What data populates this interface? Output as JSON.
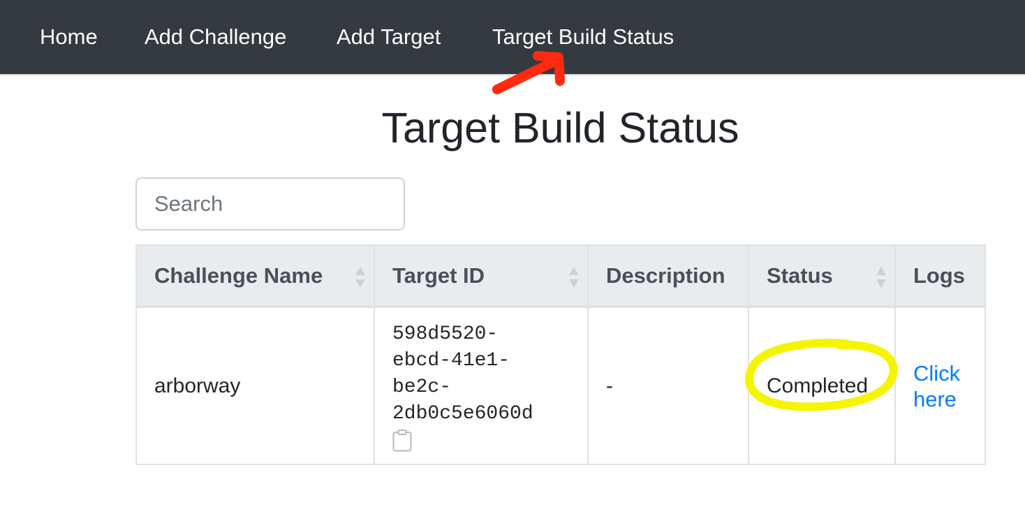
{
  "nav": {
    "home": "Home",
    "add_challenge": "Add Challenge",
    "add_target": "Add Target",
    "target_build_status": "Target Build Status"
  },
  "page": {
    "title": "Target Build Status"
  },
  "search": {
    "placeholder": "Search",
    "value": ""
  },
  "table": {
    "headers": {
      "challenge_name": "Challenge Name",
      "target_id": "Target ID",
      "description": "Description",
      "status": "Status",
      "logs": "Logs"
    },
    "rows": [
      {
        "challenge_name": "arborway",
        "target_id": "598d5520-\nebcd-41e1-\nbe2c-\n2db0c5e6060d",
        "description": "-",
        "status": "Completed",
        "logs": "Click\nhere"
      }
    ]
  },
  "icons": {
    "sort": "sort-icon",
    "clipboard": "clipboard-icon"
  },
  "colors": {
    "navbar": "#343a40",
    "link": "#007bff",
    "table_header": "#e9ecef",
    "annotation_arrow": "#ff2a10",
    "annotation_circle": "#f5f500"
  }
}
